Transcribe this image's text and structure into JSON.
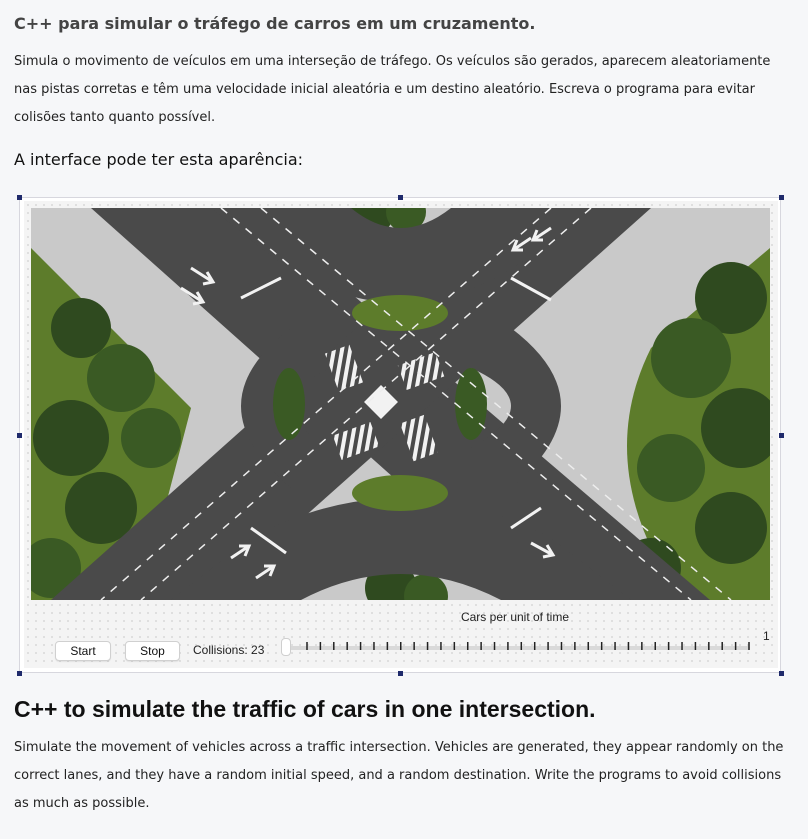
{
  "pt": {
    "title": "C++ para simular o tráfego de carros em um cruzamento.",
    "description": "Simula o movimento de veículos em uma interseção de tráfego. Os veículos são gerados, aparecem aleatoriamente nas pistas corretas e têm uma velocidade inicial aleatória e um destino aleatório. Escreva o programa para evitar colisões tanto quanto possível.",
    "interface_caption": "A interface pode ter esta aparência:"
  },
  "app": {
    "scene_image": "intersection-aerial-view",
    "cars_per_unit_label": "Cars per unit of time",
    "start_label": "Start",
    "stop_label": "Stop",
    "collisions_text": "Collisions: 23",
    "slider": {
      "value": 0,
      "max_label": "1",
      "tick_count": 34
    }
  },
  "en": {
    "title": "C++ to simulate the traffic of cars in one intersection.",
    "description": "Simulate the movement of vehicles across a traffic intersection. Vehicles are generated, they appear randomly on the correct lanes, and they have a random initial speed, and a random destination. Write the programs to avoid collisions as much as possible."
  },
  "colors": {
    "asphalt": "#4a4a4a",
    "sidewalk": "#c9c9c9",
    "grass": "#5d7c2b",
    "tree": "#2f4a1f",
    "handle": "#1f2a6b"
  }
}
